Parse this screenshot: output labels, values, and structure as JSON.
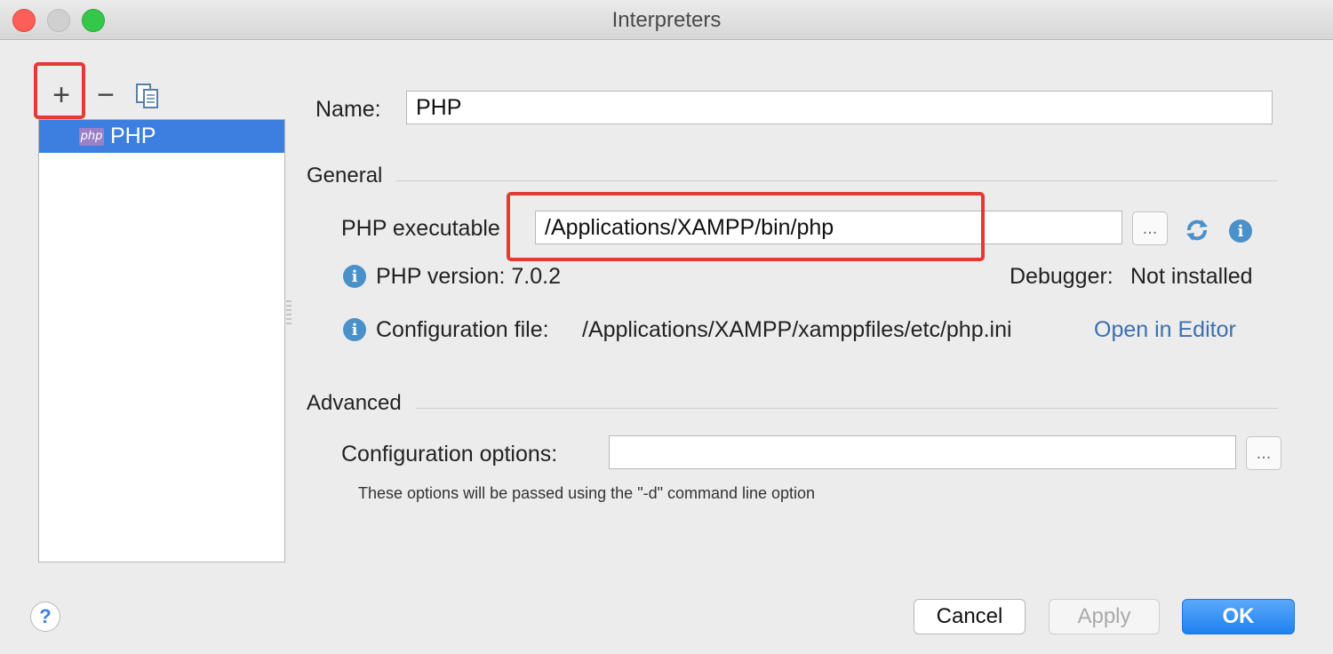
{
  "window": {
    "title": "Interpreters"
  },
  "toolbar": {
    "add": "+",
    "remove": "−"
  },
  "list": {
    "items": [
      {
        "icon": "php",
        "label": "PHP"
      }
    ]
  },
  "form": {
    "name_label": "Name:",
    "name_value": "PHP",
    "general_header": "General",
    "executable_label": "PHP executable",
    "executable_value": "/Applications/XAMPP/bin/php",
    "browse": "...",
    "php_version": "PHP version: 7.0.2",
    "debugger_label": "Debugger:",
    "debugger_value": "Not installed",
    "config_file_label": "Configuration file:",
    "config_file_value": "/Applications/XAMPP/xamppfiles/etc/php.ini",
    "open_in_editor": "Open in Editor",
    "advanced_header": "Advanced",
    "config_options_label": "Configuration options:",
    "config_options_value": "",
    "config_options_hint": "These options will be passed using the \"-d\" command line option"
  },
  "buttons": {
    "help": "?",
    "cancel": "Cancel",
    "apply": "Apply",
    "ok": "OK"
  },
  "colors": {
    "selection": "#3d7fe0",
    "highlight": "#e33b34",
    "link": "#3c6fb0",
    "ok": "#1e80f0"
  }
}
